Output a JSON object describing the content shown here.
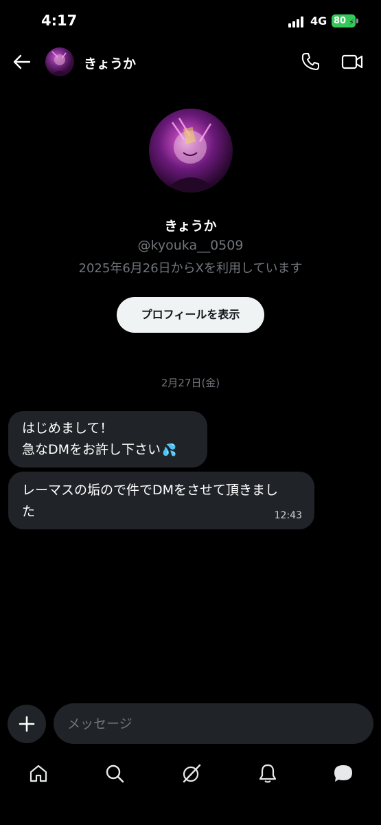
{
  "status_bar": {
    "time": "4:17",
    "network": "4G",
    "battery": "80"
  },
  "header": {
    "name": "きょうか",
    "icons": [
      "back-arrow-icon",
      "phone-icon",
      "video-icon"
    ]
  },
  "profile": {
    "name": "きょうか",
    "handle": "@kyouka__0509",
    "joined": "2025年6月26日からXを利用しています",
    "button_label": "プロフィールを表示"
  },
  "conversation": {
    "date_divider": "2月27日(金)",
    "messages": [
      {
        "lines": [
          "はじめまして！",
          "急なDMをお許し下さい"
        ],
        "emoji": "sweat-droplets-icon"
      },
      {
        "lines": [
          "レーマスの垢ので件でDMをさせて頂きまし",
          "た"
        ],
        "time": "12:43"
      }
    ]
  },
  "composer": {
    "placeholder": "メッセージ"
  },
  "nav": {
    "items": [
      "home-icon",
      "search-icon",
      "grok-icon",
      "notifications-icon",
      "messages-icon"
    ],
    "active": "messages-icon"
  },
  "colors": {
    "background": "#000000",
    "bubble": "#202327",
    "secondary_text": "#71767b",
    "battery": "#34c759"
  }
}
